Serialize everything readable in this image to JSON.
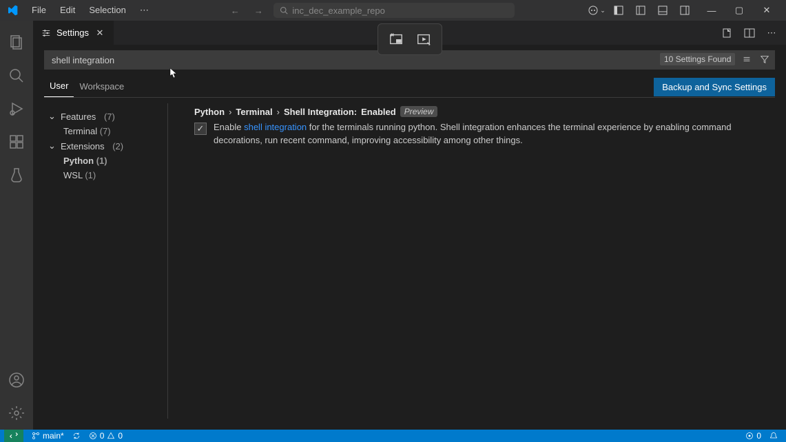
{
  "titlebar": {
    "menus": [
      "File",
      "Edit",
      "Selection"
    ],
    "more": "⋯",
    "search_placeholder": "inc_dec_example_repo"
  },
  "tab": {
    "label": "Settings"
  },
  "search": {
    "value": "shell integration",
    "found": "10 Settings Found"
  },
  "scope": {
    "user": "User",
    "workspace": "Workspace",
    "backup_btn": "Backup and Sync Settings"
  },
  "toc": {
    "features": {
      "label": "Features",
      "count": "(7)",
      "terminal": {
        "label": "Terminal",
        "count": "(7)"
      }
    },
    "extensions": {
      "label": "Extensions",
      "count": "(2)",
      "python": {
        "label": "Python",
        "count": "(1)"
      },
      "wsl": {
        "label": "WSL",
        "count": "(1)"
      }
    }
  },
  "setting": {
    "crumb1": "Python",
    "crumb2": "Terminal",
    "crumb3": "Shell Integration:",
    "value": "Enabled",
    "preview": "Preview",
    "desc_pre": "Enable ",
    "desc_link": "shell integration",
    "desc_post": " for the terminals running python. Shell integration enhances the terminal experience by enabling command decorations, run recent command, improving accessibility among other things."
  },
  "statusbar": {
    "branch": "main*",
    "errors": "0",
    "warnings": "0",
    "ports": "0"
  }
}
